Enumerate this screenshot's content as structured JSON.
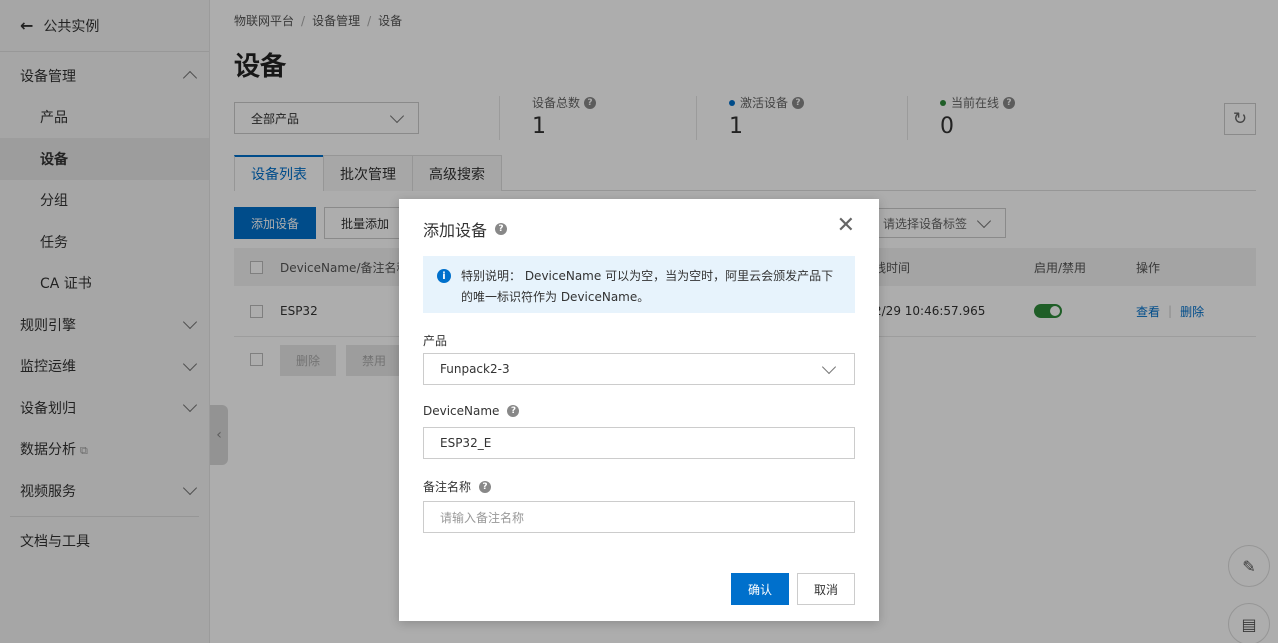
{
  "sidebar": {
    "back_label": "公共实例",
    "items": [
      {
        "label": "设备管理"
      },
      {
        "label": "产品"
      },
      {
        "label": "设备"
      },
      {
        "label": "分组"
      },
      {
        "label": "任务"
      },
      {
        "label": "CA 证书"
      },
      {
        "label": "规则引擎"
      },
      {
        "label": "监控运维"
      },
      {
        "label": "设备划归"
      },
      {
        "label": "数据分析"
      },
      {
        "label": "视频服务"
      },
      {
        "label": "文档与工具"
      }
    ]
  },
  "breadcrumb": [
    "物联网平台",
    "设备管理",
    "设备"
  ],
  "page_title": "设备",
  "product_filter": "全部产品",
  "stats": [
    {
      "label": "设备总数",
      "value": "1"
    },
    {
      "label": "激活设备",
      "value": "1",
      "color": "#0070cc"
    },
    {
      "label": "当前在线",
      "value": "0",
      "color": "#2e8b3a"
    }
  ],
  "tabs": [
    "设备列表",
    "批次管理",
    "高级搜索"
  ],
  "toolbar": {
    "add_device": "添加设备",
    "batch_add": "批量添加",
    "tag_placeholder": "请选择设备标签"
  },
  "table": {
    "headers": {
      "name": "DeviceName/备注名称",
      "last_online": "线时间",
      "enable": "启用/禁用",
      "actions": "操作"
    },
    "rows": [
      {
        "name": "ESP32",
        "last_online": "2/29 10:46:57.965",
        "enabled": true,
        "view": "查看",
        "delete": "删除"
      }
    ],
    "bulk": {
      "delete": "删除",
      "disable": "禁用"
    }
  },
  "modal": {
    "title": "添加设备",
    "notice": "特别说明： DeviceName 可以为空，当为空时，阿里云会颁发产品下的唯一标识符作为 DeviceName。",
    "product_label": "产品",
    "product_value": "Funpack2-3",
    "devicename_label": "DeviceName",
    "devicename_value": "ESP32_E",
    "remark_label": "备注名称",
    "remark_placeholder": "请输入备注名称",
    "ok": "确认",
    "cancel": "取消"
  }
}
